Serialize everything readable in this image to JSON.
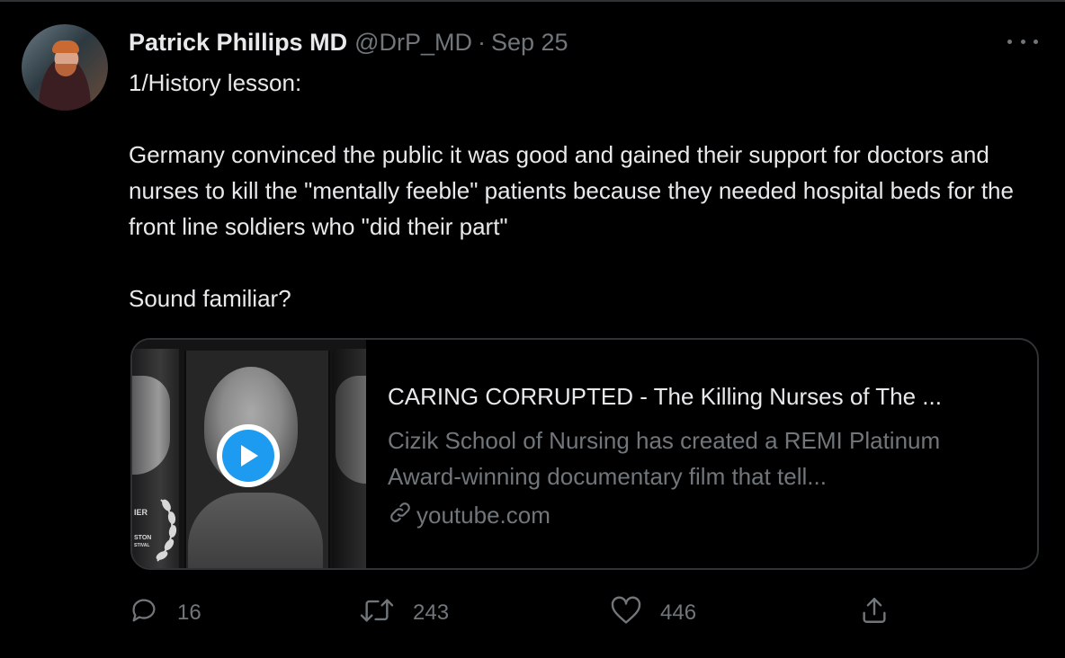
{
  "tweet": {
    "author_name": "Patrick Phillips MD",
    "handle": "@DrP_MD",
    "separator": "·",
    "date": "Sep 25",
    "text_lines": [
      "1/History lesson:",
      "Germany convinced the public it was good and gained their support for doctors and nurses to kill the \"mentally feeble\" patients because they needed hospital beds for the front line soldiers who \"did their part\"",
      "Sound familiar?"
    ]
  },
  "card": {
    "title": "CARING CORRUPTED - The Killing Nurses of The ...",
    "description": "Cizik School of Nursing has created a REMI Platinum Award-winning documentary film that tell...",
    "domain": "youtube.com",
    "thumbnail_text": [
      "IER",
      "STON",
      "STIVAL"
    ]
  },
  "actions": {
    "replies": "16",
    "retweets": "243",
    "likes": "446"
  },
  "colors": {
    "background": "#000000",
    "text": "#e7e9ea",
    "muted": "#71767b",
    "border": "#2f3336",
    "accent": "#1d9bf0"
  },
  "icons": [
    "more-icon",
    "play-icon",
    "link-icon",
    "reply-icon",
    "retweet-icon",
    "like-icon",
    "share-icon"
  ]
}
